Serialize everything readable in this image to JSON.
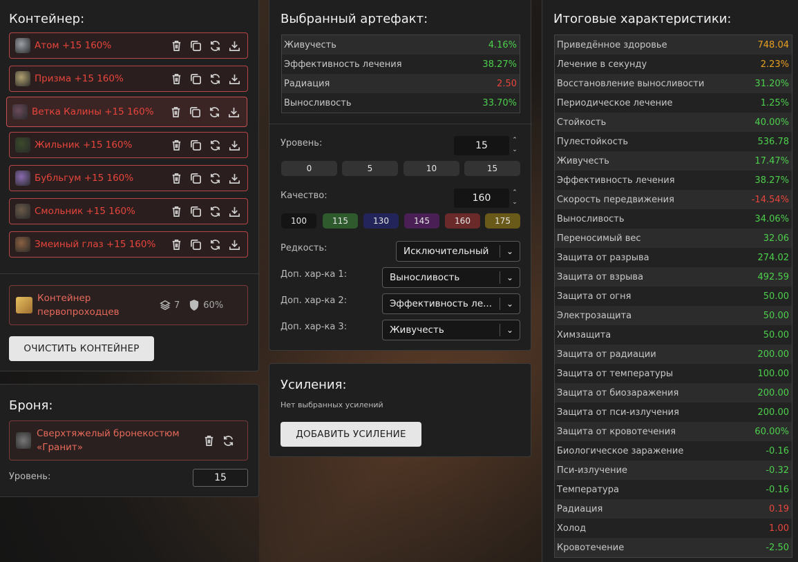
{
  "container": {
    "title": "Контейнер:",
    "artifacts": [
      {
        "name": "Атом +15 160%"
      },
      {
        "name": "Призма +15 160%"
      },
      {
        "name": "Ветка Калины +15 160%"
      },
      {
        "name": "Жильник +15 160%"
      },
      {
        "name": "Бубльгум +15 160%"
      },
      {
        "name": "Смольник +15 160%"
      },
      {
        "name": "Змеиный глаз +15 160%"
      }
    ],
    "box": {
      "name": "Контейнер первопроходцев",
      "slots": "7",
      "protection": "60%"
    },
    "clear_label": "ОЧИСТИТЬ КОНТЕЙНЕР"
  },
  "armor": {
    "title": "Броня:",
    "name": "Сверхтяжелый бронекостюм «Гранит»",
    "level_label": "Уровень:",
    "level_value": "15"
  },
  "selected": {
    "title": "Выбранный артефакт:",
    "stats": [
      {
        "name": "Живучесть",
        "value": "4.16%",
        "tone": "g"
      },
      {
        "name": "Эффективность лечения",
        "value": "38.27%",
        "tone": "g"
      },
      {
        "name": "Радиация",
        "value": "2.50",
        "tone": "r"
      },
      {
        "name": "Выносливость",
        "value": "33.70%",
        "tone": "g"
      }
    ],
    "level_label": "Уровень:",
    "level_value": "15",
    "level_presets": [
      "0",
      "5",
      "10",
      "15"
    ],
    "quality_label": "Качество:",
    "quality_value": "160",
    "quality_presets": [
      {
        "label": "100",
        "color": "#141414"
      },
      {
        "label": "115",
        "color": "#2e5a2e"
      },
      {
        "label": "130",
        "color": "#23245a"
      },
      {
        "label": "145",
        "color": "#4a1f55"
      },
      {
        "label": "160",
        "color": "#6a2a2a"
      },
      {
        "label": "175",
        "color": "#6a5a1a"
      }
    ],
    "rarity_label": "Редкость:",
    "rarity_value": "Исключительный",
    "extra1_label": "Доп. хар-ка 1:",
    "extra1_value": "Выносливость",
    "extra2_label": "Доп. хар-ка 2:",
    "extra2_value": "Эффективность ле...",
    "extra3_label": "Доп. хар-ка 3:",
    "extra3_value": "Живучесть"
  },
  "boosts": {
    "title": "Усиления:",
    "empty_text": "Нет выбранных усилений",
    "add_label": "ДОБАВИТЬ УСИЛЕНИЕ"
  },
  "totals": {
    "title": "Итоговые характеристики:",
    "stats": [
      {
        "name": "Приведённое здоровье",
        "value": "748.04",
        "tone": "o"
      },
      {
        "name": "Лечение в секунду",
        "value": "2.23%",
        "tone": "o"
      },
      {
        "name": "Восстановление выносливости",
        "value": "31.20%",
        "tone": "g"
      },
      {
        "name": "Периодическое лечение",
        "value": "1.25%",
        "tone": "g"
      },
      {
        "name": "Стойкость",
        "value": "40.00%",
        "tone": "g"
      },
      {
        "name": "Пулестойкость",
        "value": "536.78",
        "tone": "g"
      },
      {
        "name": "Живучесть",
        "value": "17.47%",
        "tone": "g"
      },
      {
        "name": "Эффективность лечения",
        "value": "38.27%",
        "tone": "g"
      },
      {
        "name": "Скорость передвижения",
        "value": "-14.54%",
        "tone": "r"
      },
      {
        "name": "Выносливость",
        "value": "34.06%",
        "tone": "g"
      },
      {
        "name": "Переносимый вес",
        "value": "32.06",
        "tone": "g"
      },
      {
        "name": "Защита от разрыва",
        "value": "274.02",
        "tone": "g"
      },
      {
        "name": "Защита от взрыва",
        "value": "492.59",
        "tone": "g"
      },
      {
        "name": "Защита от огня",
        "value": "50.00",
        "tone": "g"
      },
      {
        "name": "Электрозащита",
        "value": "50.00",
        "tone": "g"
      },
      {
        "name": "Химзащита",
        "value": "50.00",
        "tone": "g"
      },
      {
        "name": "Защита от радиации",
        "value": "200.00",
        "tone": "g"
      },
      {
        "name": "Защита от температуры",
        "value": "100.00",
        "tone": "g"
      },
      {
        "name": "Защита от биозаражения",
        "value": "200.00",
        "tone": "g"
      },
      {
        "name": "Защита от пси-излучения",
        "value": "200.00",
        "tone": "g"
      },
      {
        "name": "Защита от кровотечения",
        "value": "60.00%",
        "tone": "g"
      },
      {
        "name": "Биологическое заражение",
        "value": "-0.16",
        "tone": "g"
      },
      {
        "name": "Пси-излучение",
        "value": "-0.32",
        "tone": "g"
      },
      {
        "name": "Температура",
        "value": "-0.16",
        "tone": "g"
      },
      {
        "name": "Радиация",
        "value": "0.19",
        "tone": "r"
      },
      {
        "name": "Холод",
        "value": "1.00",
        "tone": "r"
      },
      {
        "name": "Кровотечение",
        "value": "-2.50",
        "tone": "g"
      }
    ]
  }
}
